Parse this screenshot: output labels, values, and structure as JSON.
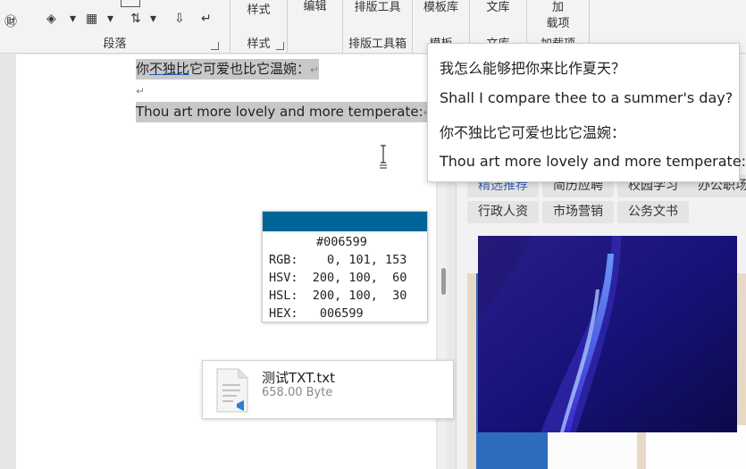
{
  "ribbon": {
    "groups": [
      {
        "label": "段落"
      },
      {
        "label": "样式",
        "big": "样式"
      },
      {
        "label": "",
        "big": "编辑"
      },
      {
        "label": "排版工具箱",
        "big": "排版工具"
      },
      {
        "label": "模板",
        "big": "模板库"
      },
      {
        "label": "文库",
        "big": "文库"
      },
      {
        "label": "加载项",
        "big": "加\n载项"
      }
    ]
  },
  "document": {
    "line1_pre": "你",
    "line1_underlined": "不独比",
    "line1_post": "它可爱也比它温婉：",
    "line3": "Thou art more lovely and more temperate:",
    "para_mark": "↵"
  },
  "popup": {
    "lines": [
      "我怎么能够把你来比作夏天？",
      "Shall I compare thee to a summer's day?",
      "你不独比它可爱也比它温婉：",
      "Thou art more lovely and more temperate:"
    ]
  },
  "colorcard": {
    "swatch": "#006599",
    "hex_title": "#006599",
    "rows": [
      "RGB:    0, 101, 153",
      "HSV:  200, 100,  60",
      "HSL:  200, 100,  30",
      "HEX:   006599"
    ]
  },
  "file": {
    "name": "测试TXT.txt",
    "size": "658.00 Byte"
  },
  "panel": {
    "tags_row1": [
      "精选推荐",
      "简历应聘",
      "校园学习",
      "办公职场"
    ],
    "tags_row2": [
      "行政人资",
      "市场营销",
      "公务文书"
    ]
  },
  "colors": {
    "accent": "#006599",
    "selection": "#c8c8c8",
    "tag_active": "#3b63b0"
  }
}
